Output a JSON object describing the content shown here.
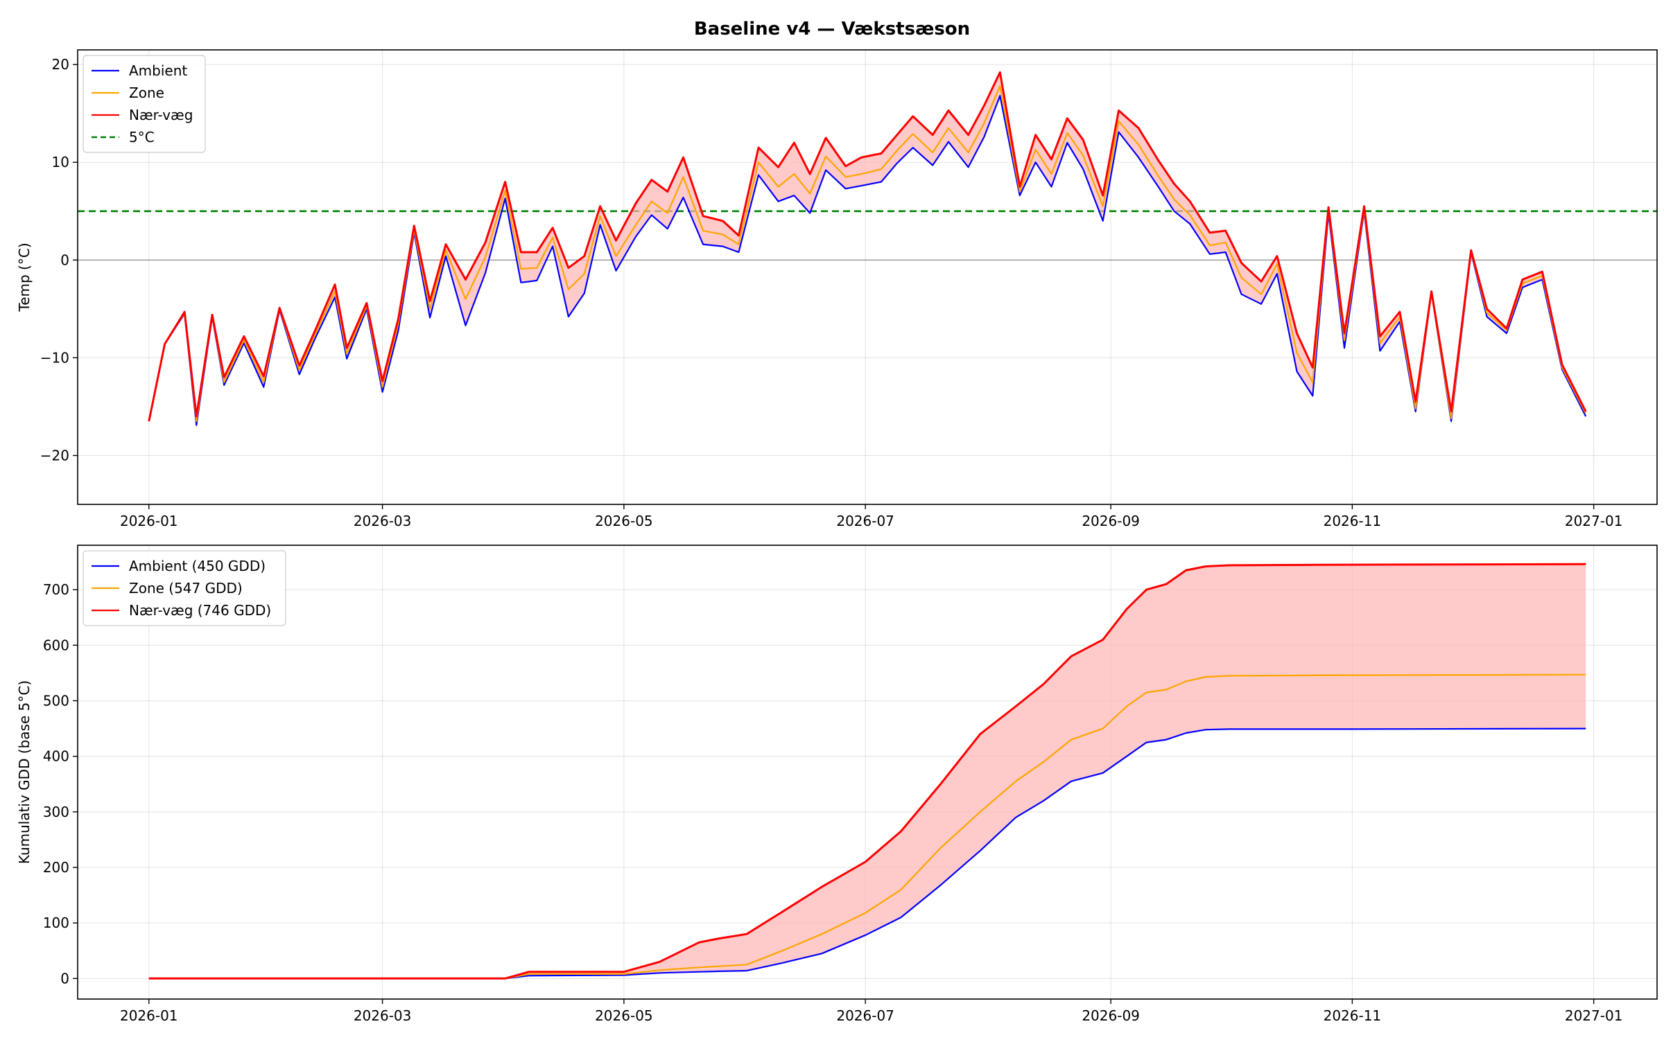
{
  "figure": {
    "suptitle": "Baseline v4 — Vækstsæson"
  },
  "colors": {
    "ambient": "#0000ff",
    "zone": "#ffa500",
    "near_wall": "#ff0000",
    "fill": "#ffb3b3",
    "threshold": "#008000"
  },
  "chart_data": [
    {
      "type": "line",
      "title": "",
      "xlabel": "",
      "ylabel": "Temp (°C)",
      "ylim": [
        -25,
        21.5
      ],
      "yticks": [
        -20,
        -10,
        0,
        10,
        20
      ],
      "ytick_labels": [
        "−20",
        "−10",
        "0",
        "10",
        "20"
      ],
      "xlim": [
        "2025-12-14",
        "2027-01-17"
      ],
      "xticks": [
        "2026-01-01",
        "2026-03-01",
        "2026-05-01",
        "2026-07-01",
        "2026-09-01",
        "2026-11-01",
        "2027-01-01"
      ],
      "xtick_labels": [
        "2026-01",
        "2026-03",
        "2026-05",
        "2026-07",
        "2026-09",
        "2026-11",
        "2027-01"
      ],
      "grid": true,
      "legend_position": "top-left",
      "fill_between": "Ambient–Nær-væg",
      "hlines": [
        {
          "name": "5°C",
          "y": 5,
          "style": "dashed"
        },
        {
          "y": 0,
          "style": "solid-thin"
        }
      ],
      "x": [
        "2026-01-01",
        "2026-01-05",
        "2026-01-10",
        "2026-01-13",
        "2026-01-17",
        "2026-01-20",
        "2026-01-25",
        "2026-01-30",
        "2026-02-03",
        "2026-02-08",
        "2026-02-12",
        "2026-02-17",
        "2026-02-20",
        "2026-02-25",
        "2026-03-01",
        "2026-03-05",
        "2026-03-09",
        "2026-03-13",
        "2026-03-17",
        "2026-03-22",
        "2026-03-27",
        "2026-04-01",
        "2026-04-05",
        "2026-04-09",
        "2026-04-13",
        "2026-04-17",
        "2026-04-21",
        "2026-04-25",
        "2026-04-29",
        "2026-05-04",
        "2026-05-08",
        "2026-05-12",
        "2026-05-16",
        "2026-05-21",
        "2026-05-26",
        "2026-05-30",
        "2026-06-04",
        "2026-06-09",
        "2026-06-13",
        "2026-06-17",
        "2026-06-21",
        "2026-06-26",
        "2026-06-30",
        "2026-07-05",
        "2026-07-09",
        "2026-07-13",
        "2026-07-18",
        "2026-07-22",
        "2026-07-27",
        "2026-07-31",
        "2026-08-04",
        "2026-08-09",
        "2026-08-13",
        "2026-08-17",
        "2026-08-21",
        "2026-08-25",
        "2026-08-30",
        "2026-09-03",
        "2026-09-08",
        "2026-09-13",
        "2026-09-17",
        "2026-09-21",
        "2026-09-26",
        "2026-09-30",
        "2026-10-04",
        "2026-10-09",
        "2026-10-13",
        "2026-10-18",
        "2026-10-22",
        "2026-10-26",
        "2026-10-30",
        "2026-11-04",
        "2026-11-08",
        "2026-11-13",
        "2026-11-17",
        "2026-11-21",
        "2026-11-26",
        "2026-12-01",
        "2026-12-05",
        "2026-12-10",
        "2026-12-14",
        "2026-12-19",
        "2026-12-24",
        "2026-12-30"
      ],
      "series": [
        {
          "name": "Ambient",
          "color_key": "ambient",
          "values": [
            -16.5,
            -8.6,
            -5.5,
            -16.9,
            -5.8,
            -12.8,
            -8.5,
            -13.0,
            -5.1,
            -11.7,
            -8.0,
            -3.8,
            -10.1,
            -5.0,
            -13.5,
            -7.2,
            2.8,
            -5.9,
            0.4,
            -6.7,
            -1.3,
            6.3,
            -2.3,
            -2.1,
            1.4,
            -5.8,
            -3.4,
            3.6,
            -1.1,
            2.4,
            4.6,
            3.2,
            6.4,
            1.6,
            1.4,
            0.8,
            8.7,
            6.0,
            6.6,
            4.8,
            9.2,
            7.3,
            7.6,
            8.0,
            9.9,
            11.5,
            9.7,
            12.1,
            9.5,
            12.6,
            16.8,
            6.6,
            10.0,
            7.5,
            12.0,
            9.3,
            4.0,
            13.1,
            10.5,
            7.5,
            5.0,
            3.7,
            0.6,
            0.8,
            -3.5,
            -4.5,
            -1.4,
            -11.4,
            -13.9,
            4.8,
            -9.0,
            5.0,
            -9.3,
            -6.3,
            -15.5,
            -3.3,
            -16.5,
            0.8,
            -5.8,
            -7.5,
            -2.8,
            -2.0,
            -11.2,
            -16.0
          ]
        },
        {
          "name": "Zone",
          "color_key": "zone",
          "values": [
            -16.5,
            -8.6,
            -5.4,
            -16.5,
            -5.7,
            -12.5,
            -8.2,
            -12.5,
            -5.0,
            -11.3,
            -7.6,
            -3.2,
            -9.6,
            -4.7,
            -13.0,
            -6.5,
            3.1,
            -5.0,
            1.0,
            -4.0,
            0.3,
            7.1,
            -0.9,
            -0.8,
            2.3,
            -3.0,
            -1.4,
            4.5,
            0.4,
            3.6,
            6.0,
            4.8,
            8.5,
            3.0,
            2.6,
            1.6,
            10.0,
            7.5,
            8.8,
            6.8,
            10.6,
            8.5,
            8.8,
            9.3,
            11.2,
            12.9,
            11.0,
            13.5,
            11.0,
            14.0,
            17.8,
            7.0,
            11.3,
            8.8,
            13.0,
            10.7,
            5.5,
            14.2,
            11.8,
            8.6,
            6.2,
            4.6,
            1.5,
            1.8,
            -1.8,
            -3.5,
            -0.4,
            -9.5,
            -12.5,
            5.1,
            -8.2,
            5.2,
            -8.5,
            -5.8,
            -15.2,
            -3.3,
            -16.2,
            0.9,
            -5.4,
            -7.2,
            -2.4,
            -1.6,
            -11.0,
            -15.7
          ]
        },
        {
          "name": "Nær-væg",
          "color_key": "near_wall",
          "values": [
            -16.5,
            -8.6,
            -5.3,
            -16.0,
            -5.6,
            -12.0,
            -7.8,
            -11.9,
            -4.9,
            -10.8,
            -7.2,
            -2.5,
            -9.0,
            -4.4,
            -12.4,
            -6.0,
            3.5,
            -4.2,
            1.6,
            -2.0,
            1.8,
            8.0,
            0.8,
            0.8,
            3.3,
            -0.8,
            0.4,
            5.5,
            2.0,
            5.8,
            8.2,
            7.0,
            10.5,
            4.5,
            4.0,
            2.5,
            11.5,
            9.5,
            12.0,
            8.8,
            12.5,
            9.6,
            10.5,
            10.9,
            12.8,
            14.7,
            12.8,
            15.3,
            12.8,
            15.8,
            19.2,
            7.5,
            12.8,
            10.3,
            14.5,
            12.3,
            6.6,
            15.3,
            13.5,
            10.2,
            7.8,
            6.0,
            2.8,
            3.0,
            -0.3,
            -2.2,
            0.4,
            -7.5,
            -11.0,
            5.4,
            -7.5,
            5.5,
            -7.8,
            -5.3,
            -14.5,
            -3.2,
            -15.5,
            1.0,
            -5.0,
            -7.0,
            -2.0,
            -1.2,
            -10.7,
            -15.5
          ]
        },
        {
          "name": "5°C",
          "color_key": "threshold",
          "style": "dashed",
          "values": []
        }
      ]
    },
    {
      "type": "line",
      "title": "",
      "xlabel": "",
      "ylabel": "Kumulativ GDD (base 5°C)",
      "ylim": [
        -37,
        780
      ],
      "yticks": [
        0,
        100,
        200,
        300,
        400,
        500,
        600,
        700
      ],
      "ytick_labels": [
        "0",
        "100",
        "200",
        "300",
        "400",
        "500",
        "600",
        "700"
      ],
      "xlim": [
        "2025-12-14",
        "2027-01-17"
      ],
      "xticks": [
        "2026-01-01",
        "2026-03-01",
        "2026-05-01",
        "2026-07-01",
        "2026-09-01",
        "2026-11-01",
        "2027-01-01"
      ],
      "xtick_labels": [
        "2026-01",
        "2026-03",
        "2026-05",
        "2026-07",
        "2026-09",
        "2026-11",
        "2027-01"
      ],
      "grid": true,
      "legend_position": "top-left",
      "fill_between": "Ambient–Nær-væg",
      "x": [
        "2026-01-01",
        "2026-04-01",
        "2026-04-07",
        "2026-05-01",
        "2026-05-10",
        "2026-05-20",
        "2026-05-25",
        "2026-06-01",
        "2026-06-10",
        "2026-06-20",
        "2026-07-01",
        "2026-07-10",
        "2026-07-20",
        "2026-07-30",
        "2026-08-08",
        "2026-08-15",
        "2026-08-22",
        "2026-08-30",
        "2026-09-05",
        "2026-09-10",
        "2026-09-15",
        "2026-09-20",
        "2026-09-25",
        "2026-10-01",
        "2026-10-31",
        "2026-12-30"
      ],
      "series": [
        {
          "name": "Ambient (450 GDD)",
          "color_key": "ambient",
          "values": [
            0,
            0,
            5,
            6,
            10,
            12,
            13,
            14,
            28,
            45,
            78,
            110,
            168,
            230,
            290,
            320,
            355,
            370,
            400,
            425,
            430,
            442,
            448,
            449,
            449,
            450
          ]
        },
        {
          "name": "Zone (547 GDD)",
          "color_key": "zone",
          "values": [
            0,
            0,
            8,
            8,
            15,
            20,
            22,
            25,
            50,
            80,
            118,
            160,
            235,
            300,
            355,
            390,
            430,
            450,
            490,
            515,
            520,
            535,
            543,
            545,
            546,
            547
          ]
        },
        {
          "name": "Nær-væg (746 GDD)",
          "color_key": "near_wall",
          "values": [
            0,
            0,
            12,
            12,
            30,
            65,
            72,
            80,
            120,
            165,
            210,
            265,
            350,
            440,
            490,
            530,
            580,
            610,
            665,
            700,
            710,
            735,
            742,
            744,
            745,
            746
          ]
        }
      ]
    }
  ]
}
